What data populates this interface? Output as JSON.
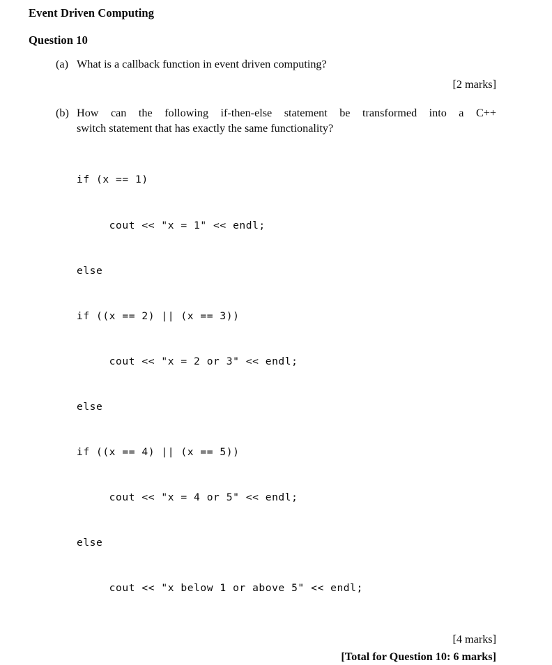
{
  "document": {
    "title": "Event Driven Computing",
    "question_heading": "Question 10"
  },
  "parts": {
    "a": {
      "label": "(a)",
      "text": "What is a callback function in event driven computing?",
      "marks": "[2 marks]"
    },
    "b": {
      "label": "(b)",
      "line_1": "How can the following if-then-else statement be transformed into a C++",
      "line_2": "switch statement that has exactly the same functionality?",
      "marks": "[4 marks]"
    }
  },
  "code": {
    "lines": [
      "if (x == 1)",
      "     cout << \"x = 1\" << endl;",
      "else",
      "if ((x == 2) || (x == 3))",
      "     cout << \"x = 2 or 3\" << endl;",
      "else",
      "if ((x == 4) || (x == 5))",
      "     cout << \"x = 4 or 5\" << endl;",
      "else",
      "     cout << \"x below 1 or above 5\" << endl;"
    ]
  },
  "footer": {
    "total": "[Total for Question 10: 6 marks]"
  },
  "colors": {
    "page_background": "#ffffff",
    "text": "#0a0a0a"
  }
}
